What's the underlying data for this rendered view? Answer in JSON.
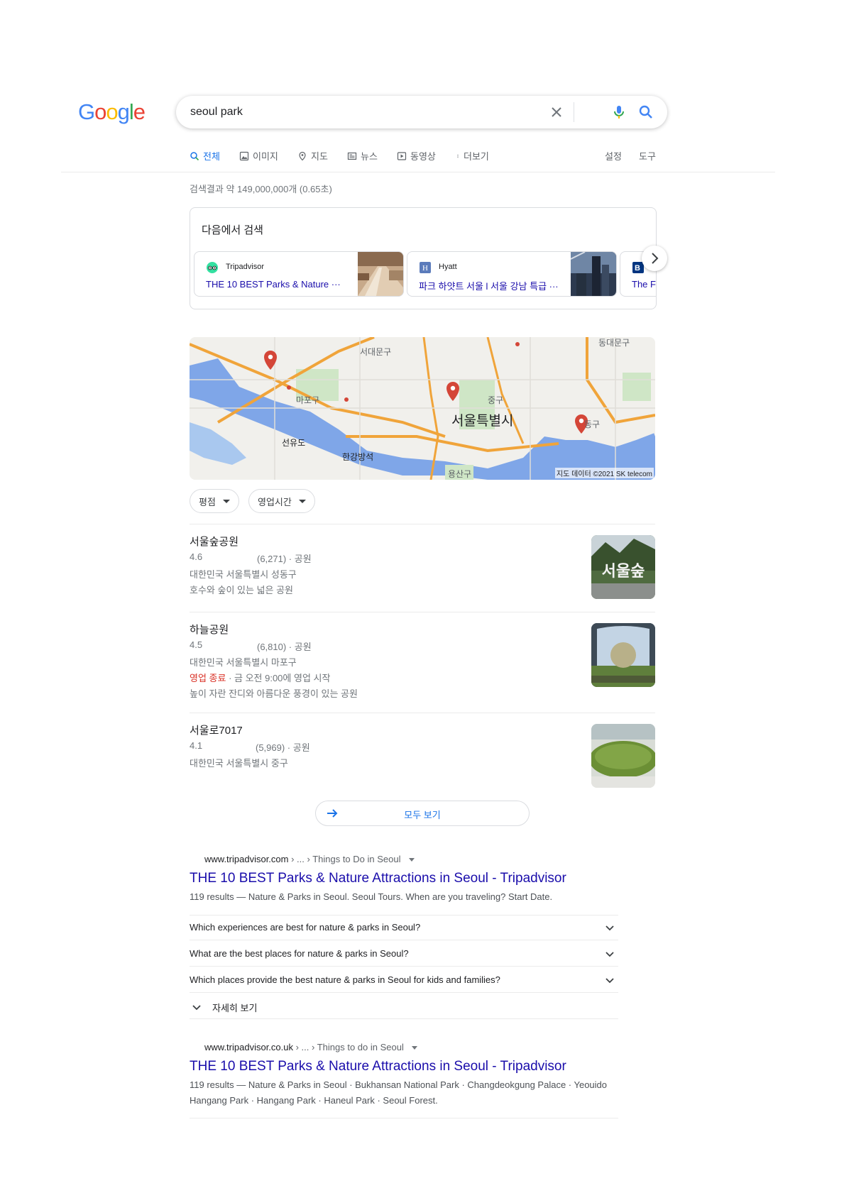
{
  "logo": {
    "letters": [
      "G",
      "o",
      "o",
      "g",
      "l",
      "e"
    ]
  },
  "search": {
    "query": "seoul park"
  },
  "tabs": [
    {
      "label": "전체",
      "icon": "search-icon"
    },
    {
      "label": "이미지",
      "icon": "image-icon"
    },
    {
      "label": "지도",
      "icon": "map-pin-icon"
    },
    {
      "label": "뉴스",
      "icon": "news-icon"
    },
    {
      "label": "동영상",
      "icon": "video-icon"
    },
    {
      "label": "더보기",
      "icon": "more-dots-icon"
    }
  ],
  "tools": {
    "settings": "설정",
    "tools": "도구"
  },
  "stats": "검색결과 약 149,000,000개 (0.65초)",
  "search_in": {
    "heading": "다음에서 검색",
    "cards": [
      {
        "site": "Tripadvisor",
        "title": "THE 10 BEST Parks & Nature ···"
      },
      {
        "site": "Hyatt",
        "title": "파크 하얏트 서울 l 서울 강남 특급 ···"
      },
      {
        "site": "",
        "title": "The F"
      }
    ]
  },
  "map": {
    "labels": [
      "서대문구",
      "동대문구",
      "마포구",
      "중구",
      "서울특별시",
      "동구",
      "선유도",
      "한강방석",
      "용산구"
    ],
    "copyright": "지도 데이터 ©2021 SK telecom"
  },
  "filters": [
    {
      "label": "평점"
    },
    {
      "label": "영업시간"
    }
  ],
  "places": [
    {
      "name": "서울숲공원",
      "rating": "4.6",
      "meta": "(6,271) · 공원",
      "address": "대한민국 서울특별시 성동구",
      "status": "",
      "status_rest": "",
      "desc": "호수와 숲이 있는 넓은 공원"
    },
    {
      "name": "하늘공원",
      "rating": "4.5",
      "meta": "(6,810) · 공원",
      "address": "대한민국 서울특별시 마포구",
      "status": "영업 종료",
      "status_rest": " · 금 오전 9:00에 영업 시작",
      "desc": "높이 자란 잔디와 아름다운 풍경이 있는 공원"
    },
    {
      "name": "서울로7017",
      "rating": "4.1",
      "meta": "(5,969) · 공원",
      "address": "대한민국 서울특별시 중구",
      "status": "",
      "status_rest": "",
      "desc": ""
    }
  ],
  "see_all": "모두 보기",
  "results": [
    {
      "domain": "www.tripadvisor.com",
      "breadcrumb": " › ... › Things to Do in Seoul",
      "title": "THE 10 BEST Parks & Nature Attractions in Seoul - Tripadvisor",
      "snippet": "119 results — Nature & Parks in Seoul. Seoul Tours. When are you traveling? Start Date.",
      "faqs": [
        "Which experiences are best for nature & parks in Seoul?",
        "What are the best places for nature & parks in Seoul?",
        "Which places provide the best nature & parks in Seoul for kids and families?"
      ],
      "more": "자세히 보기"
    },
    {
      "domain": "www.tripadvisor.co.uk",
      "breadcrumb": " › ... › Things to do in Seoul",
      "title": "THE 10 BEST Parks & Nature Attractions in Seoul - Tripadvisor",
      "snippet_line1": "119 results — Nature & Parks in Seoul · Bukhansan National Park · Changdeokgung Palace · Yeouido",
      "snippet_line2": "Hangang Park · Hangang Park · Haneul Park · Seoul Forest."
    }
  ],
  "colors": {
    "blue": "#4285F4",
    "red": "#EA4335",
    "yellow": "#FBBC05",
    "green": "#34A853",
    "link": "#1a0dab",
    "accent": "#1a73e8"
  }
}
